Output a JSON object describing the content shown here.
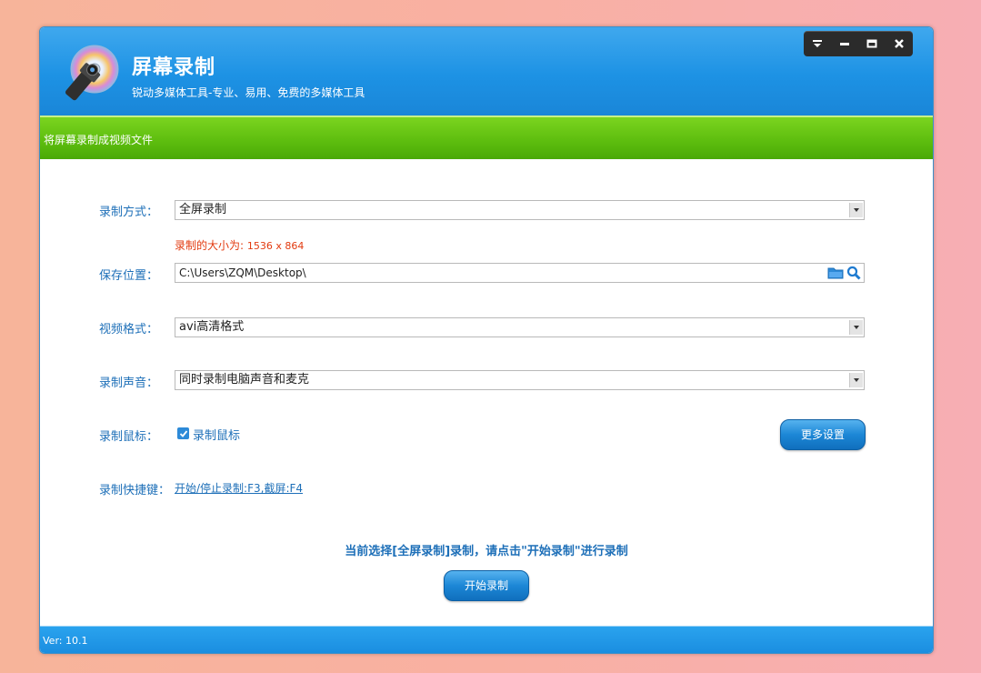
{
  "app": {
    "title": "屏幕录制",
    "subtitle": "锐动多媒体工具-专业、易用、免费的多媒体工具"
  },
  "window_controls": {
    "menu_icon": "menu-down-icon",
    "minimize_icon": "minimize-icon",
    "maximize_icon": "maximize-icon",
    "close_icon": "close-icon"
  },
  "section": {
    "title": "将屏幕录制成视频文件"
  },
  "form": {
    "mode_label": "录制方式：",
    "mode_value": "全屏录制",
    "size_note_prefix": "录制的大小为:",
    "size_note_value": "1536 x 864",
    "save_label": "保存位置：",
    "save_value": "C:\\Users\\ZQM\\Desktop\\",
    "format_label": "视频格式：",
    "format_value": "avi高清格式",
    "audio_label": "录制声音：",
    "audio_value": "同时录制电脑声音和麦克",
    "mouse_label": "录制鼠标：",
    "mouse_checkbox_label": "录制鼠标",
    "mouse_checked": true,
    "more_settings_button": "更多设置",
    "shortcut_label": "录制快捷键：",
    "shortcut_link": "开始/停止录制:F3,截屏:F4"
  },
  "status": {
    "message": "当前选择[全屏录制]录制，请点击\"开始录制\"进行录制",
    "start_button": "开始录制"
  },
  "footer": {
    "version": "Ver: 10.1"
  },
  "colors": {
    "title_blue": "#1d92e4",
    "green_bar": "#5cbc0e",
    "label_blue": "#1d6fb8",
    "note_red": "#e23a0f"
  }
}
